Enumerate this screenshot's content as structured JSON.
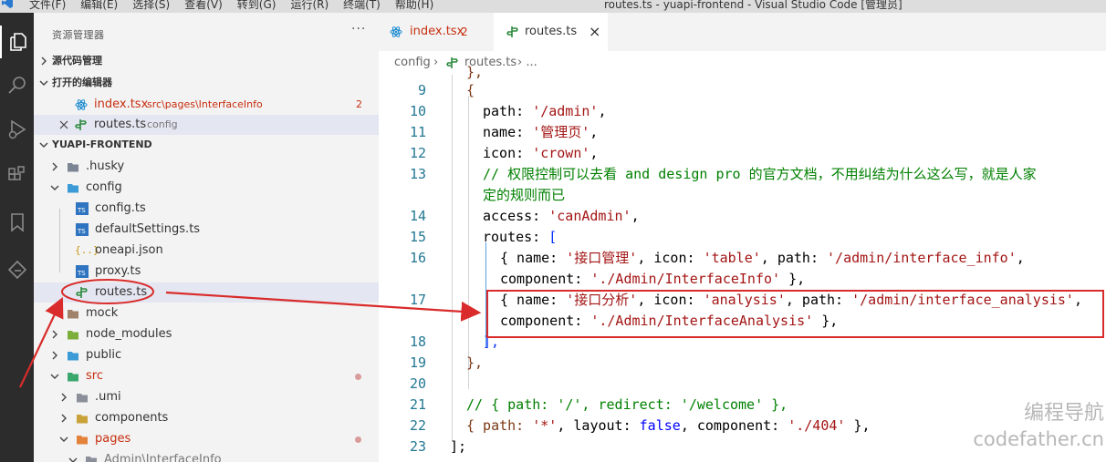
{
  "titlebar": {
    "menu": [
      "文件(F)",
      "编辑(E)",
      "选择(S)",
      "查看(V)",
      "转到(G)",
      "运行(R)",
      "终端(T)",
      "帮助(H)"
    ],
    "title": "routes.ts - yuapi-frontend - Visual Studio Code [管理员]"
  },
  "sidebar": {
    "title": "资源管理器",
    "more": "···",
    "sections": {
      "scm": "源代码管理",
      "open_editors": "打开的编辑器",
      "project": "YUAPI-FRONTEND"
    },
    "open_editors": [
      {
        "name": "index.tsx",
        "path": "src\\pages\\InterfaceInfo",
        "problems": "2"
      },
      {
        "name": "routes.ts",
        "path": "config"
      }
    ],
    "tree": {
      "husky": ".husky",
      "config": "config",
      "config_ts": "config.ts",
      "default_settings": "defaultSettings.ts",
      "oneapi": "oneapi.json",
      "proxy": "proxy.ts",
      "routes": "routes.ts",
      "mock": "mock",
      "node_modules": "node_modules",
      "public": "public",
      "src": "src",
      "umi": ".umi",
      "components": "components",
      "pages": "pages",
      "admin_interface": "Admin\\InterfaceInfo"
    }
  },
  "tabs": [
    {
      "label": "index.tsx",
      "badge": "2"
    },
    {
      "label": "routes.ts",
      "close": "×"
    }
  ],
  "breadcrumb": {
    "folder": "config",
    "sep": "›",
    "file": "routes.ts",
    "rest": "› ..."
  },
  "editor": {
    "line_numbers": [
      "9",
      "10",
      "11",
      "12",
      "13",
      "14",
      "15",
      "16",
      "17",
      "18",
      "19",
      "20",
      "21",
      "22",
      "23"
    ],
    "lines": {
      "l9": "{",
      "l10a": "path: ",
      "l10b": "'/admin'",
      "l10c": ",",
      "l11a": "name: ",
      "l11b": "'管理页'",
      "l11c": ",",
      "l12a": "icon: ",
      "l12b": "'crown'",
      "l12c": ",",
      "l13a": "// 权限控制可以去看 and design pro 的官方文档，不用纠结为什么这么写，就是人家",
      "l13b": "定的规则而已",
      "l14a": "access: ",
      "l14b": "'canAdmin'",
      "l14c": ",",
      "l15a": "routes: ",
      "l15b": "[",
      "l16a": "{ name: ",
      "l16b": "'接口管理'",
      "l16c": ", icon: ",
      "l16d": "'table'",
      "l16e": ", path: ",
      "l16f": "'/admin/interface_info'",
      "l16g": ",",
      "l16h": "component: ",
      "l16i": "'./Admin/InterfaceInfo'",
      "l16j": " },",
      "l17a": "{ name: ",
      "l17b": "'接口分析'",
      "l17c": ", icon: ",
      "l17d": "'analysis'",
      "l17e": ", path: ",
      "l17f": "'/admin/interface_analysis'",
      "l17g": ",",
      "l17h": "component: ",
      "l17i": "'./Admin/InterfaceAnalysis'",
      "l17j": " },",
      "l18": "],",
      "l19": "},",
      "l21": "// { path: '/', redirect: '/welcome' },",
      "l22a": "{ path: ",
      "l22b": "'*'",
      "l22c": ", layout: ",
      "l22d": "false",
      "l22e": ", component: ",
      "l22f": "'./404'",
      "l22g": " },",
      "l23": "];"
    }
  },
  "watermark": {
    "line1": "编程导航",
    "line2": "codefather.cn"
  },
  "colors": {
    "annotation": "#d92b2b",
    "string": "#a31515",
    "comment": "#008000",
    "keyword": "#0000ff",
    "error": "#c72e0f"
  }
}
